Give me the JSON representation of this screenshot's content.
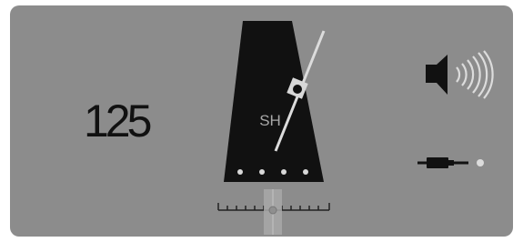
{
  "tempo": {
    "bpm": "125"
  },
  "metronome": {
    "label": "SH",
    "beats_per_bar": 4,
    "body_color": "#111111",
    "pendulum_color": "#dcdcdc",
    "beat_dot_color": "#d8d8d8"
  },
  "panel": {
    "background": "#8c8c8c"
  },
  "icons": {
    "speaker": "speaker-volume-icon",
    "audio_cable": "audio-cable-icon",
    "status_dot": "status-dot-icon"
  }
}
